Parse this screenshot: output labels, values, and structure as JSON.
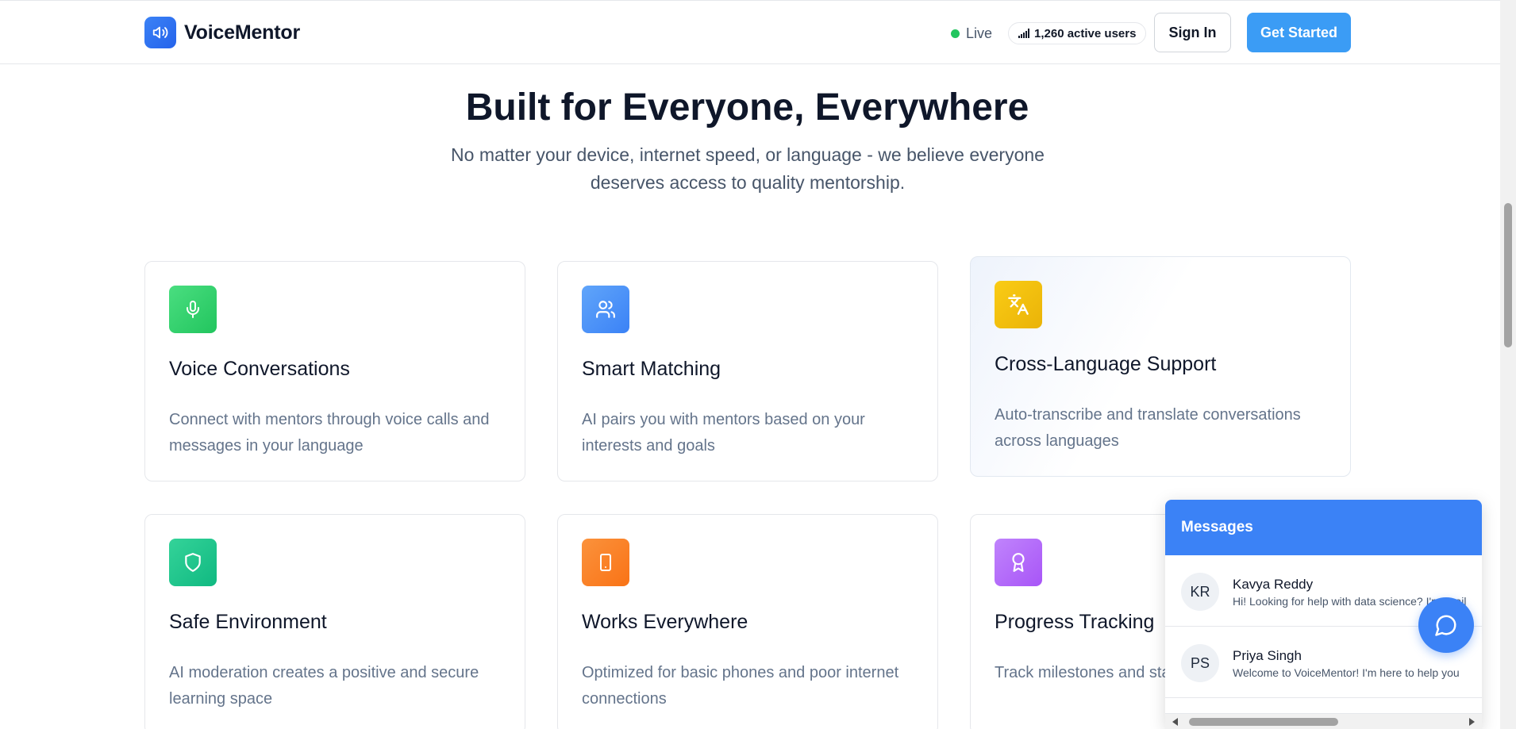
{
  "header": {
    "brand": "VoiceMentor",
    "live_label": "Live",
    "active_users": "1,260 active users",
    "sign_in_label": "Sign In",
    "get_started_label": "Get Started"
  },
  "section": {
    "title": "Built for Everyone, Everywhere",
    "subtitle": "No matter your device, internet speed, or language - we believe everyone deserves access to quality mentorship."
  },
  "features": [
    {
      "title": "Voice Conversations",
      "description": "Connect with mentors through voice calls and messages in your language",
      "icon": "microphone-icon",
      "color": "#22c55e"
    },
    {
      "title": "Smart Matching",
      "description": "AI pairs you with mentors based on your interests and goals",
      "icon": "users-icon",
      "color": "#3b82f6"
    },
    {
      "title": "Cross-Language Support",
      "description": "Auto-transcribe and translate conversations across languages",
      "icon": "translate-icon",
      "color": "#eab308"
    },
    {
      "title": "Safe Environment",
      "description": "AI moderation creates a positive and secure learning space",
      "icon": "shield-icon",
      "color": "#10b981"
    },
    {
      "title": "Works Everywhere",
      "description": "Optimized for basic phones and poor internet connections",
      "icon": "phone-icon",
      "color": "#f97316"
    },
    {
      "title": "Progress Tracking",
      "description": "Track milestones and sta achievements",
      "icon": "award-icon",
      "color": "#a855f7"
    }
  ],
  "messages": {
    "title": "Messages",
    "items": [
      {
        "initials": "KR",
        "name": "Kavya Reddy",
        "preview": "Hi! Looking for help with data science? I'm avail"
      },
      {
        "initials": "PS",
        "name": "Priya Singh",
        "preview": "Welcome to VoiceMentor! I'm here to help you"
      }
    ]
  }
}
